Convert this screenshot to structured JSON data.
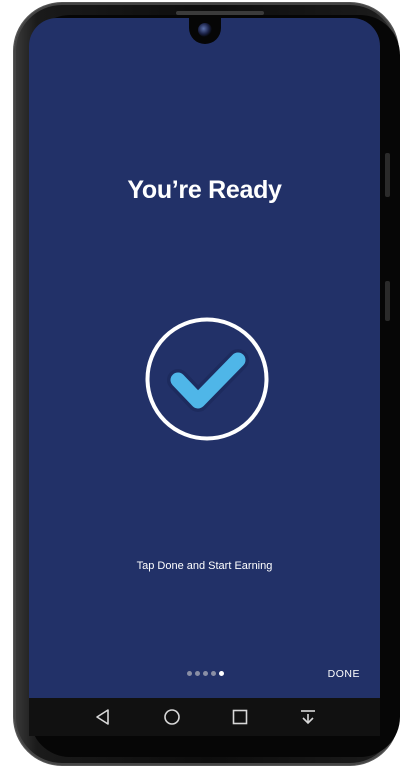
{
  "screen": {
    "title": "You’re Ready",
    "subtitle": "Tap Done and Start Earning",
    "done_label": "DONE",
    "page_indicator": {
      "count": 5,
      "active_index": 4
    }
  },
  "colors": {
    "screen_bg": "#223168",
    "check_fill": "#4fb6e8",
    "check_outline": "#1d2b5e",
    "ring": "#ffffff"
  },
  "navbar": {
    "icons": [
      "back-icon",
      "home-icon",
      "recents-icon",
      "notification-pull-icon"
    ]
  }
}
